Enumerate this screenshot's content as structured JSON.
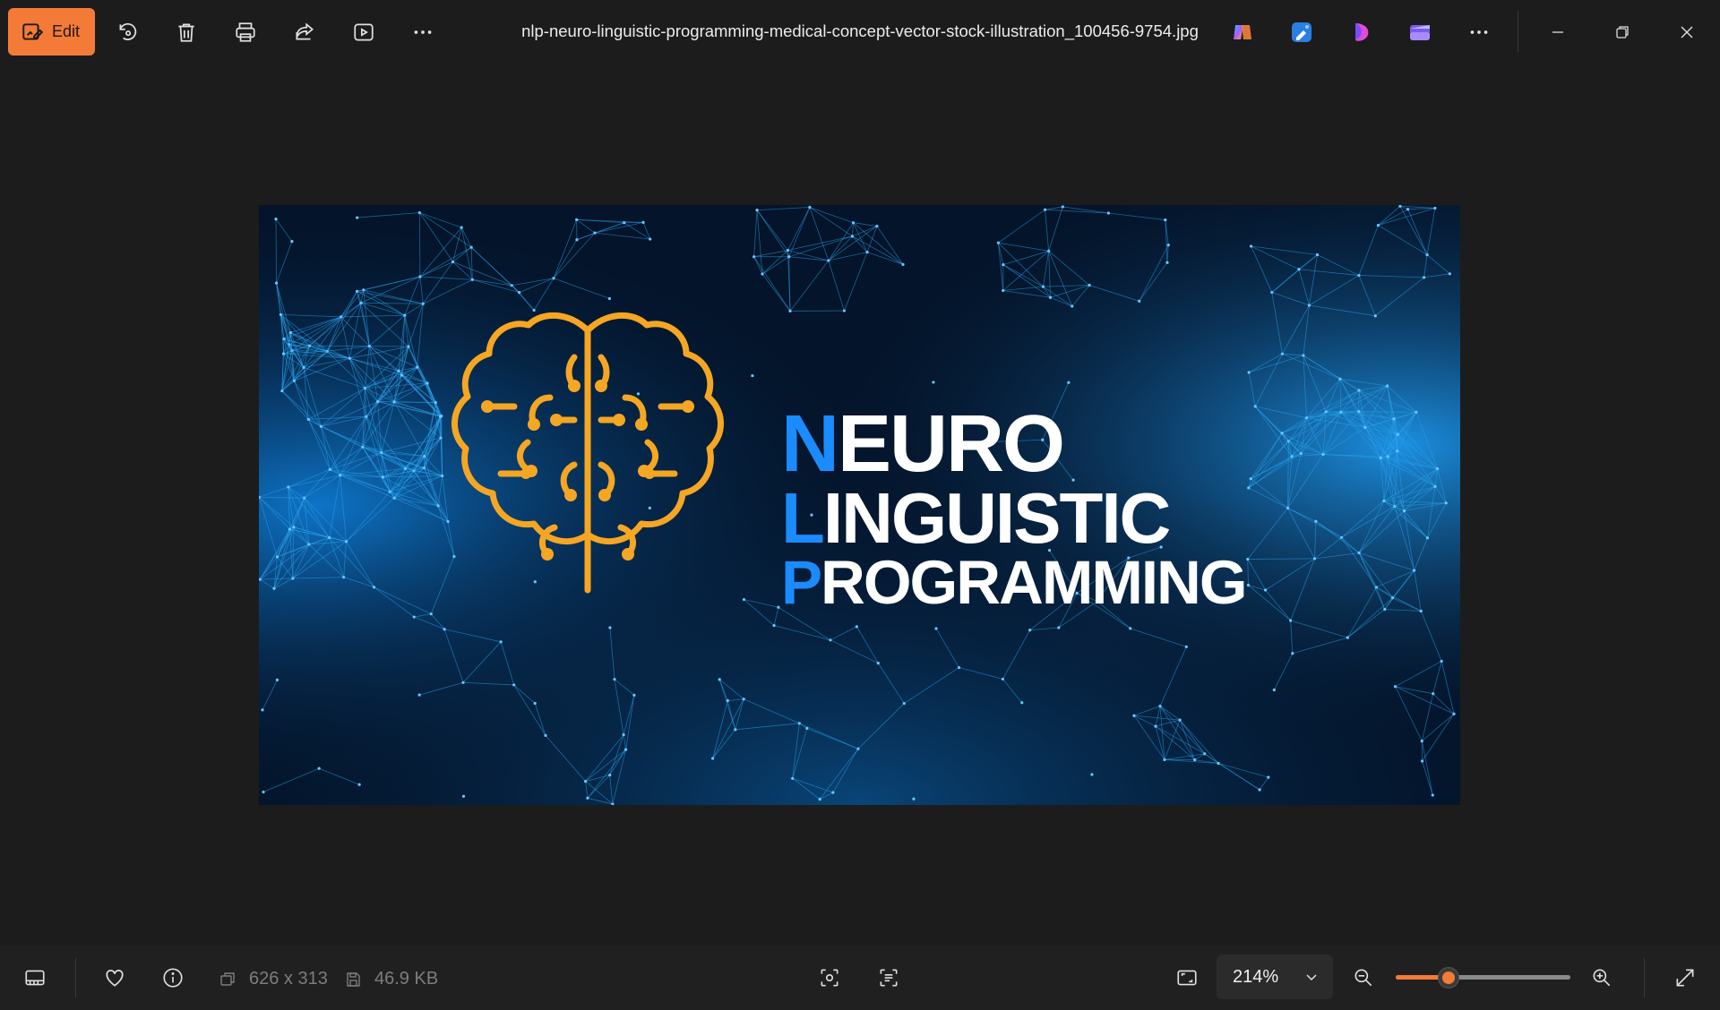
{
  "toolbar": {
    "edit_label": "Edit",
    "icons": [
      "rotate-icon",
      "delete-icon",
      "print-icon",
      "share-icon",
      "slideshow-icon",
      "more-icon"
    ]
  },
  "file": {
    "name": "nlp-neuro-linguistic-programming-medical-concept-vector-stock-illustration_100456-9754.jpg"
  },
  "apps": [
    "copilot-icon",
    "photo-editor-icon",
    "designer-icon",
    "clipchamp-icon"
  ],
  "image": {
    "lines": [
      {
        "initial": "N",
        "rest": "EURO"
      },
      {
        "initial": "L",
        "rest": "INGUISTIC"
      },
      {
        "initial": "P",
        "rest": "ROGRAMMING"
      }
    ],
    "colors": {
      "background": "#04142a",
      "network": "#1a9be8",
      "brain": "#f5a623",
      "initials": "#1a8cff",
      "text": "#ffffff"
    }
  },
  "status": {
    "dimensions": "626 x 313",
    "file_size": "46.9 KB"
  },
  "zoom": {
    "value": "214%",
    "slider_fraction": 0.3
  },
  "accent": "#f47b37"
}
